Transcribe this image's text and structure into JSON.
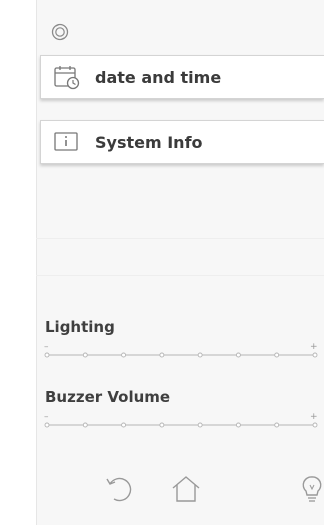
{
  "menu": {
    "items": [
      {
        "label": "date and time",
        "icon": "calendar-clock-icon"
      },
      {
        "label": "System Info",
        "icon": "info-icon"
      }
    ],
    "top_icon": "refresh-circle-icon"
  },
  "sliders": [
    {
      "label": "Lighting",
      "min_symbol": "–",
      "max_symbol": "+",
      "steps": 8,
      "level": 1.0
    },
    {
      "label": "Buzzer Volume",
      "min_symbol": "–",
      "max_symbol": "+",
      "steps": 8,
      "level": 1.0
    }
  ],
  "nav": {
    "icons": [
      "back-icon",
      "home-icon",
      "lightbulb-icon"
    ]
  },
  "colors": {
    "panel_bg": "#f7f7f7",
    "button_bg": "#ffffff",
    "text": "#3b3b3b",
    "line": "#b5b5b5"
  }
}
